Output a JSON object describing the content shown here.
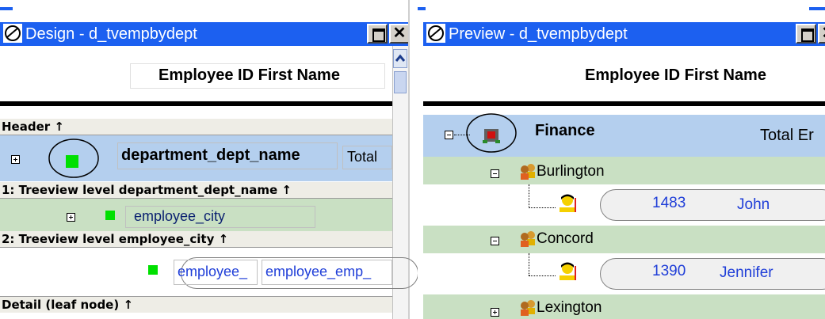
{
  "design": {
    "title": "Design - d_tvempbydept",
    "header_text": "Employee ID First Name",
    "bands": [
      {
        "label": "Header"
      },
      {
        "label": "1: Treeview level department_dept_name"
      },
      {
        "label": "2: Treeview level employee_city"
      },
      {
        "label": "Detail (leaf node)"
      }
    ],
    "fields": {
      "dept_name": "department_dept_name",
      "total": "Total",
      "city": "employee_city",
      "emp_id": "employee_",
      "emp_fname": "employee_emp_"
    }
  },
  "preview": {
    "title": "Preview - d_tvempbydept",
    "header_text": "Employee ID First Name",
    "department": "Finance",
    "total_label": "Total Er",
    "cities": [
      {
        "name": "Burlington",
        "employee_id": "1483",
        "first_name": "John"
      },
      {
        "name": "Concord",
        "employee_id": "1390",
        "first_name": "Jennifer"
      },
      {
        "name": "Lexington"
      }
    ]
  },
  "colors": {
    "titlebar": "#1c60f0",
    "header_band": "#b4cfee",
    "level_band": "#c9e0c3",
    "band_label_bg": "#eeede6",
    "marker": "#00e000"
  },
  "icons": [
    "app-icon",
    "minimize-restore-icon",
    "close-icon",
    "scroll-up-icon",
    "expand-plus-icon",
    "collapse-minus-icon",
    "department-icon",
    "city-group-icon",
    "person-icon"
  ]
}
